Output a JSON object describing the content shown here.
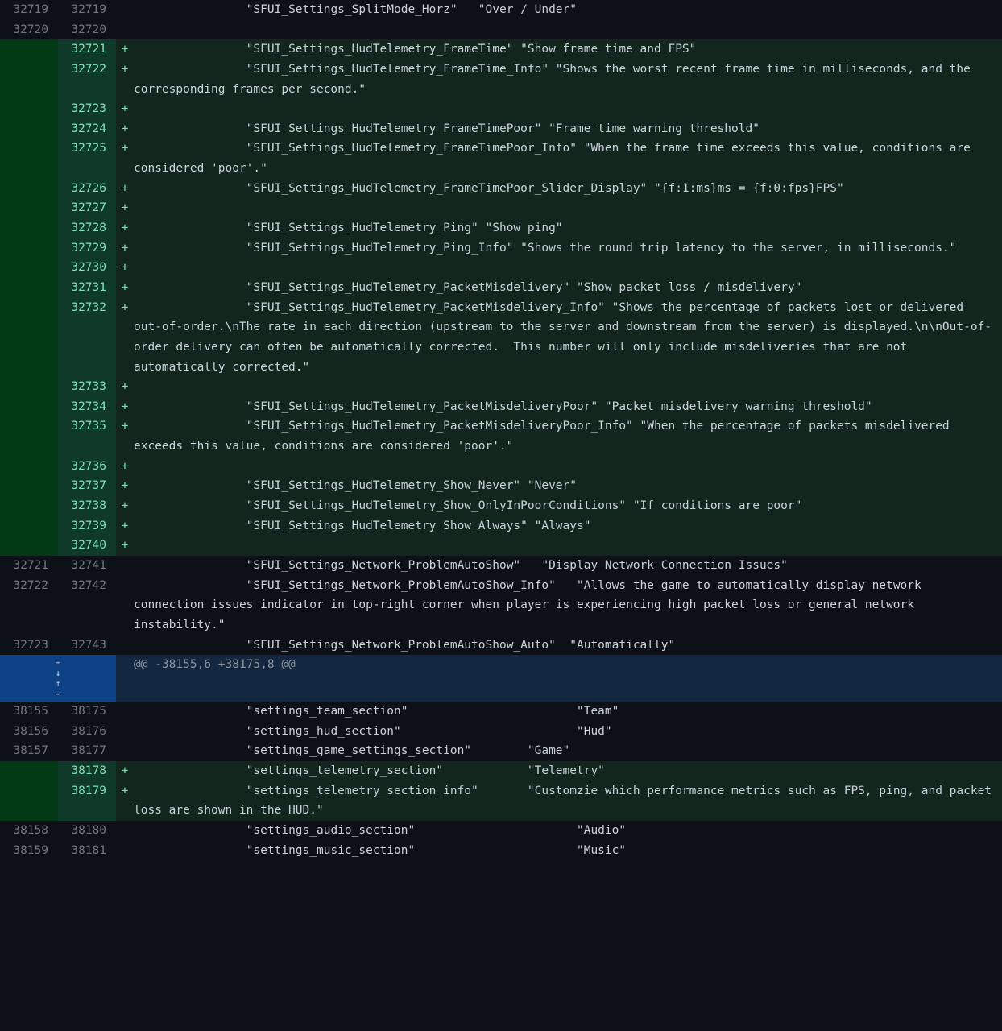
{
  "hunk_header": "@@ -38155,6 +38175,8 @@",
  "rows": [
    {
      "type": "context",
      "old": "32719",
      "new": "32719",
      "marker": "",
      "text": "                \"SFUI_Settings_SplitMode_Horz\"   \"Over / Under\""
    },
    {
      "type": "context",
      "old": "32720",
      "new": "32720",
      "marker": "",
      "text": ""
    },
    {
      "type": "add",
      "old": "",
      "new": "32721",
      "marker": "+",
      "text": "                \"SFUI_Settings_HudTelemetry_FrameTime\" \"Show frame time and FPS\""
    },
    {
      "type": "add",
      "old": "",
      "new": "32722",
      "marker": "+",
      "text": "                \"SFUI_Settings_HudTelemetry_FrameTime_Info\" \"Shows the worst recent frame time in milliseconds, and the corresponding frames per second.\""
    },
    {
      "type": "add",
      "old": "",
      "new": "32723",
      "marker": "+",
      "text": ""
    },
    {
      "type": "add",
      "old": "",
      "new": "32724",
      "marker": "+",
      "text": "                \"SFUI_Settings_HudTelemetry_FrameTimePoor\" \"Frame time warning threshold\""
    },
    {
      "type": "add",
      "old": "",
      "new": "32725",
      "marker": "+",
      "text": "                \"SFUI_Settings_HudTelemetry_FrameTimePoor_Info\" \"When the frame time exceeds this value, conditions are considered 'poor'.\""
    },
    {
      "type": "add",
      "old": "",
      "new": "32726",
      "marker": "+",
      "text": "                \"SFUI_Settings_HudTelemetry_FrameTimePoor_Slider_Display\" \"{f:1:ms}ms = {f:0:fps}FPS\""
    },
    {
      "type": "add",
      "old": "",
      "new": "32727",
      "marker": "+",
      "text": ""
    },
    {
      "type": "add",
      "old": "",
      "new": "32728",
      "marker": "+",
      "text": "                \"SFUI_Settings_HudTelemetry_Ping\" \"Show ping\""
    },
    {
      "type": "add",
      "old": "",
      "new": "32729",
      "marker": "+",
      "text": "                \"SFUI_Settings_HudTelemetry_Ping_Info\" \"Shows the round trip latency to the server, in milliseconds.\""
    },
    {
      "type": "add",
      "old": "",
      "new": "32730",
      "marker": "+",
      "text": ""
    },
    {
      "type": "add",
      "old": "",
      "new": "32731",
      "marker": "+",
      "text": "                \"SFUI_Settings_HudTelemetry_PacketMisdelivery\" \"Show packet loss / misdelivery\""
    },
    {
      "type": "add",
      "old": "",
      "new": "32732",
      "marker": "+",
      "text": "                \"SFUI_Settings_HudTelemetry_PacketMisdelivery_Info\" \"Shows the percentage of packets lost or delivered out-of-order.\\nThe rate in each direction (upstream to the server and downstream from the server) is displayed.\\n\\nOut-of-order delivery can often be automatically corrected.  This number will only include misdeliveries that are not automatically corrected.\""
    },
    {
      "type": "add",
      "old": "",
      "new": "32733",
      "marker": "+",
      "text": ""
    },
    {
      "type": "add",
      "old": "",
      "new": "32734",
      "marker": "+",
      "text": "                \"SFUI_Settings_HudTelemetry_PacketMisdeliveryPoor\" \"Packet misdelivery warning threshold\""
    },
    {
      "type": "add",
      "old": "",
      "new": "32735",
      "marker": "+",
      "text": "                \"SFUI_Settings_HudTelemetry_PacketMisdeliveryPoor_Info\" \"When the percentage of packets misdelivered exceeds this value, conditions are considered 'poor'.\""
    },
    {
      "type": "add",
      "old": "",
      "new": "32736",
      "marker": "+",
      "text": ""
    },
    {
      "type": "add",
      "old": "",
      "new": "32737",
      "marker": "+",
      "text": "                \"SFUI_Settings_HudTelemetry_Show_Never\" \"Never\""
    },
    {
      "type": "add",
      "old": "",
      "new": "32738",
      "marker": "+",
      "text": "                \"SFUI_Settings_HudTelemetry_Show_OnlyInPoorConditions\" \"If conditions are poor\""
    },
    {
      "type": "add",
      "old": "",
      "new": "32739",
      "marker": "+",
      "text": "                \"SFUI_Settings_HudTelemetry_Show_Always\" \"Always\""
    },
    {
      "type": "add",
      "old": "",
      "new": "32740",
      "marker": "+",
      "text": ""
    },
    {
      "type": "context",
      "old": "32721",
      "new": "32741",
      "marker": "",
      "text": "                \"SFUI_Settings_Network_ProblemAutoShow\"   \"Display Network Connection Issues\""
    },
    {
      "type": "context",
      "old": "32722",
      "new": "32742",
      "marker": "",
      "text": "                \"SFUI_Settings_Network_ProblemAutoShow_Info\"   \"Allows the game to automatically display network connection issues indicator in top-right corner when player is experiencing high packet loss or general network instability.\""
    },
    {
      "type": "context",
      "old": "32723",
      "new": "32743",
      "marker": "",
      "text": "                \"SFUI_Settings_Network_ProblemAutoShow_Auto\"  \"Automatically\""
    },
    {
      "type": "hunk"
    },
    {
      "type": "context",
      "old": "38155",
      "new": "38175",
      "marker": "",
      "text": "                \"settings_team_section\"                        \"Team\""
    },
    {
      "type": "context",
      "old": "38156",
      "new": "38176",
      "marker": "",
      "text": "                \"settings_hud_section\"                         \"Hud\""
    },
    {
      "type": "context",
      "old": "38157",
      "new": "38177",
      "marker": "",
      "text": "                \"settings_game_settings_section\"        \"Game\""
    },
    {
      "type": "add",
      "old": "",
      "new": "38178",
      "marker": "+",
      "text": "                \"settings_telemetry_section\"            \"Telemetry\""
    },
    {
      "type": "add",
      "old": "",
      "new": "38179",
      "marker": "+",
      "text": "                \"settings_telemetry_section_info\"       \"Customzie which performance metrics such as FPS, ping, and packet loss are shown in the HUD.\""
    },
    {
      "type": "context",
      "old": "38158",
      "new": "38180",
      "marker": "",
      "text": "                \"settings_audio_section\"                       \"Audio\""
    },
    {
      "type": "context",
      "old": "38159",
      "new": "38181",
      "marker": "",
      "text": "                \"settings_music_section\"                       \"Music\""
    }
  ]
}
